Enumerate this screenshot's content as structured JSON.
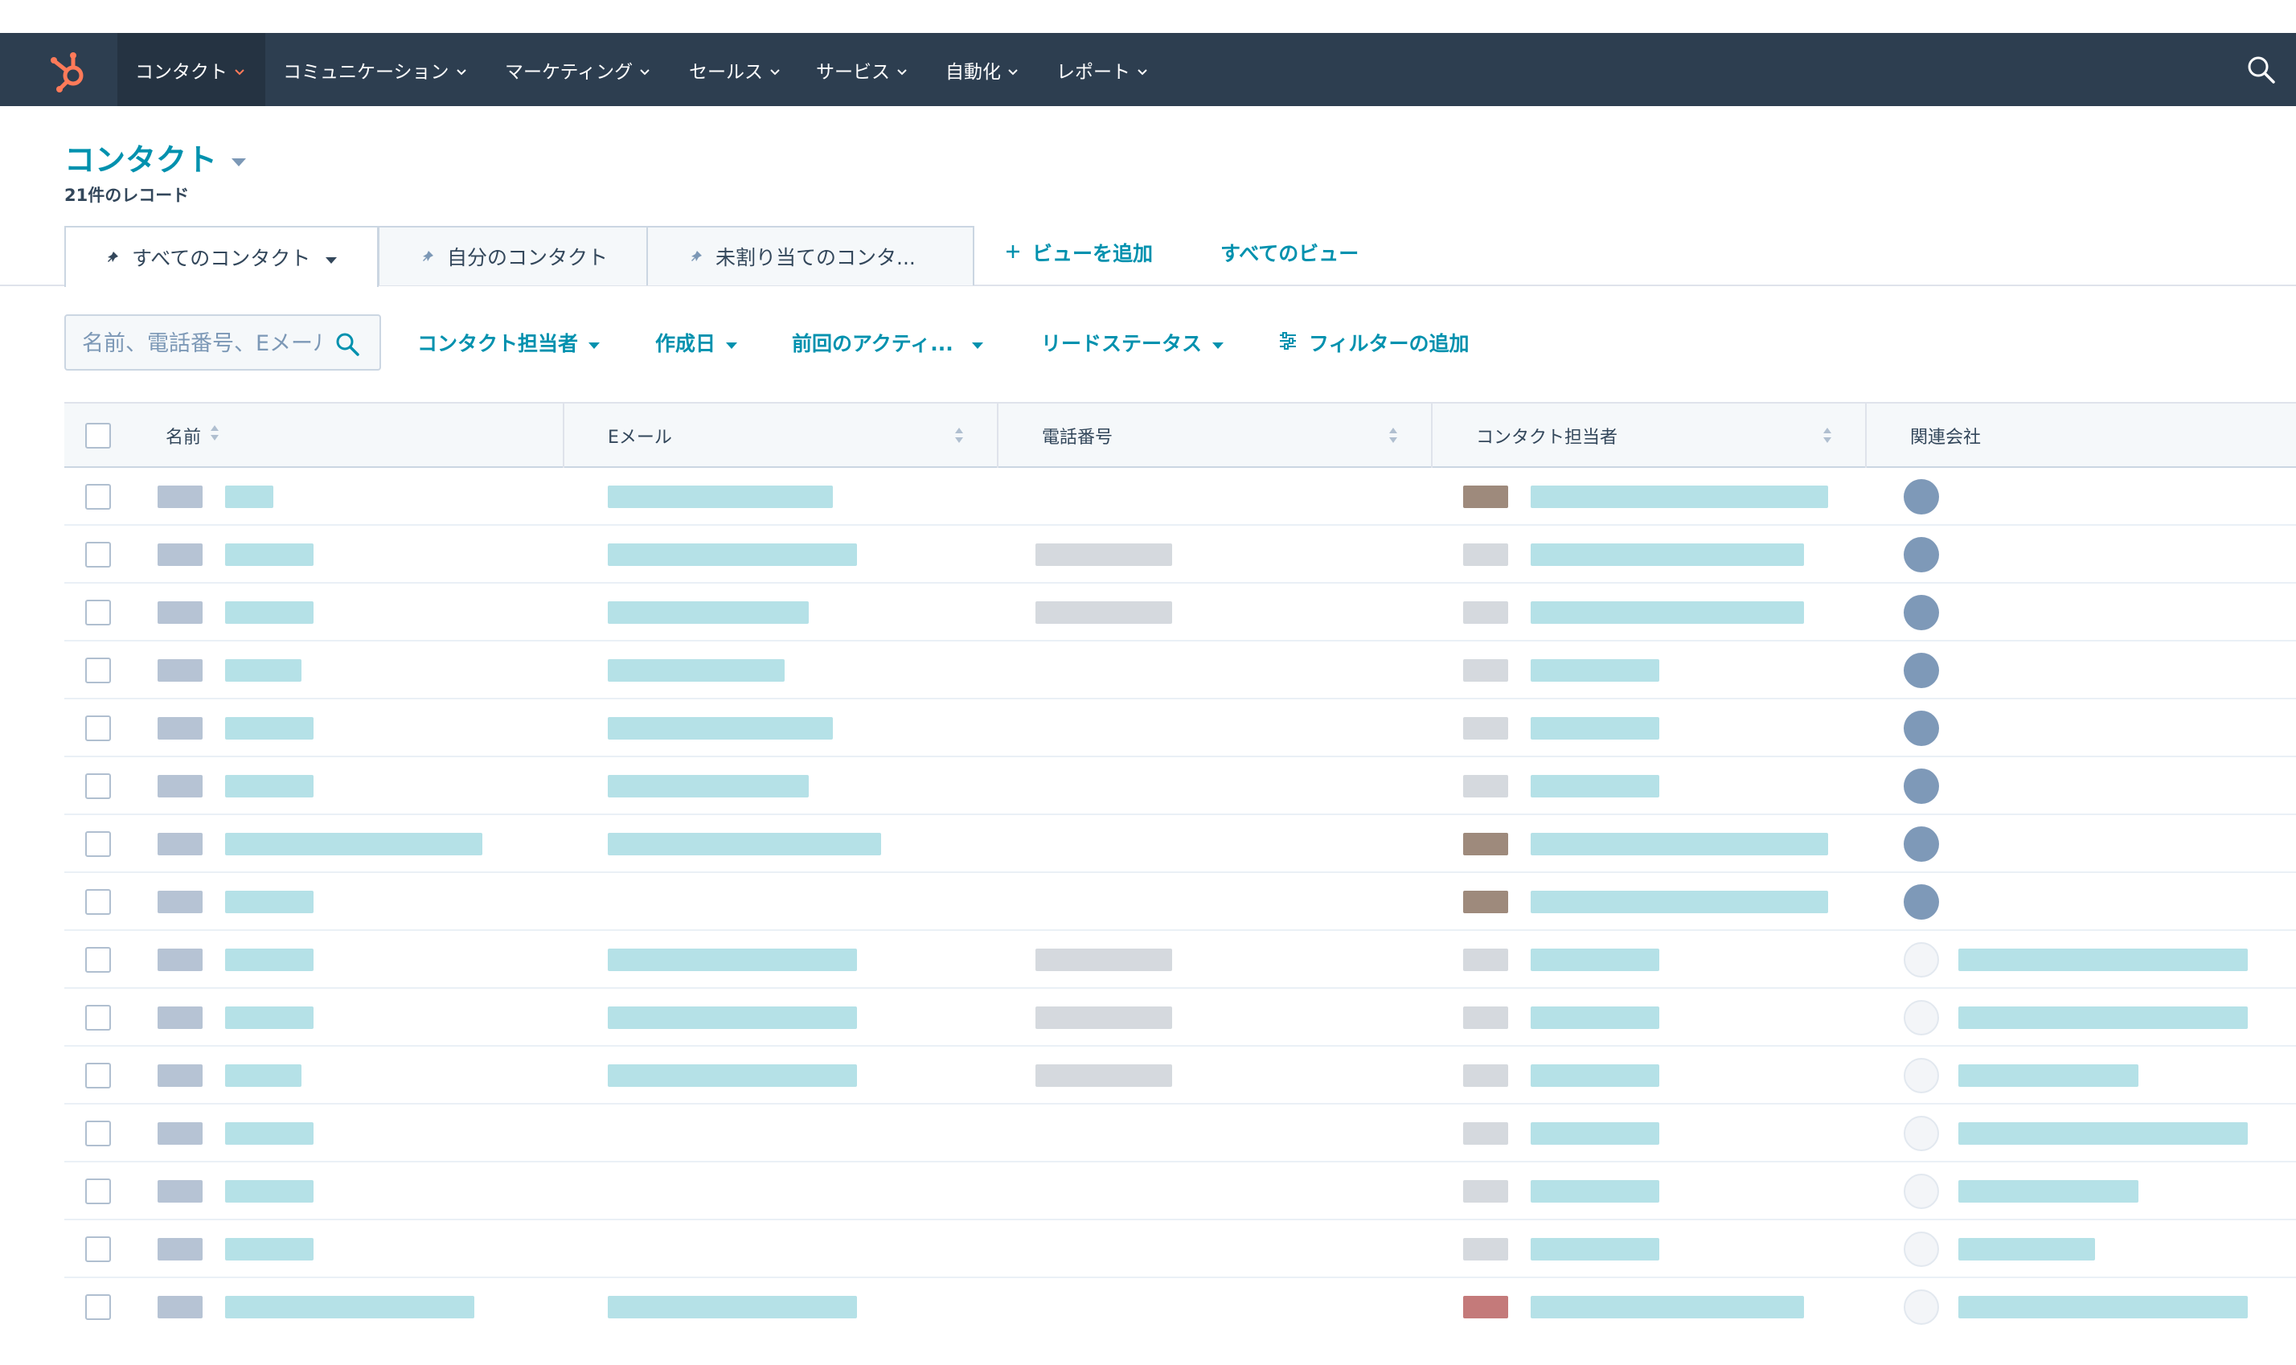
{
  "nav": {
    "items": [
      {
        "label": "コンタクト",
        "active": true
      },
      {
        "label": "コミュニケーション"
      },
      {
        "label": "マーケティング"
      },
      {
        "label": "セールス"
      },
      {
        "label": "サービス"
      },
      {
        "label": "自動化"
      },
      {
        "label": "レポート"
      }
    ],
    "logo_icon": "hubspot-sprocket-icon",
    "search_icon": "search-icon",
    "accent_color": "#ff7a59"
  },
  "page": {
    "title": "コンタクト",
    "record_count": "21件のレコード"
  },
  "views": {
    "tabs": [
      {
        "label": "すべてのコンタクト",
        "active": true
      },
      {
        "label": "自分のコンタクト"
      },
      {
        "label": "未割り当てのコンタ..."
      }
    ],
    "add_view": "ビューを追加",
    "all_views": "すべてのビュー"
  },
  "filters": {
    "search_placeholder": "名前、電話番号、Eメール",
    "items": [
      {
        "label": "コンタクト担当者"
      },
      {
        "label": "作成日"
      },
      {
        "label": "前回のアクティ..."
      },
      {
        "label": "リードステータス"
      }
    ],
    "add_filter": "フィルターの追加"
  },
  "table": {
    "columns": [
      {
        "label": "名前"
      },
      {
        "label": "Eメール"
      },
      {
        "label": "電話番号"
      },
      {
        "label": "コンタクト担当者"
      },
      {
        "label": "関連会社"
      }
    ],
    "row_count_visible": 15,
    "company_avatar_type": [
      "person",
      "person",
      "person",
      "person",
      "person",
      "person",
      "person",
      "person",
      "company",
      "company",
      "company",
      "company",
      "company",
      "company",
      "company"
    ]
  },
  "colors": {
    "nav_bg": "#2d3e50",
    "link": "#0091ae",
    "text": "#33475b"
  }
}
